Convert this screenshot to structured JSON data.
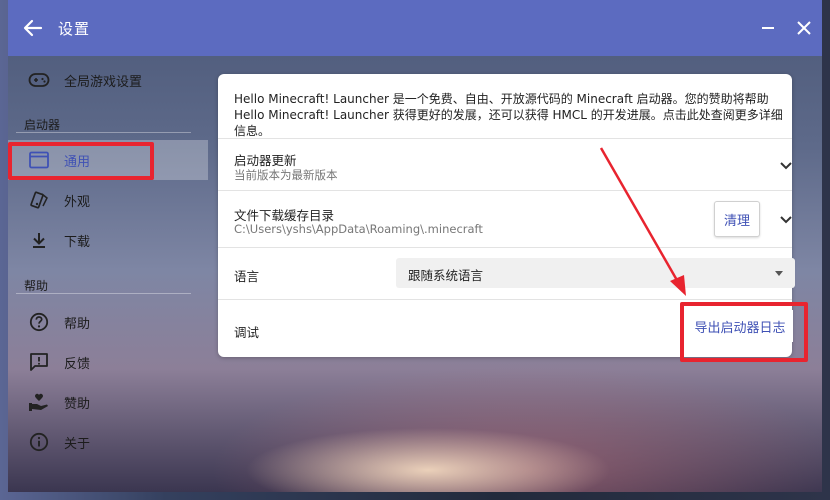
{
  "window": {
    "title": "设置"
  },
  "sidebar": {
    "items": [
      {
        "label": "全局游戏设置",
        "icon": "gamepad-icon"
      },
      {
        "label": "通用",
        "icon": "window-icon",
        "selected": true
      },
      {
        "label": "外观",
        "icon": "palette-icon"
      },
      {
        "label": "下载",
        "icon": "download-icon"
      },
      {
        "label": "帮助",
        "icon": "help-icon"
      },
      {
        "label": "反馈",
        "icon": "feedback-icon"
      },
      {
        "label": "赞助",
        "icon": "donate-icon"
      },
      {
        "label": "关于",
        "icon": "info-icon"
      }
    ],
    "sections": {
      "launcher": "启动器",
      "help": "帮助"
    }
  },
  "main": {
    "intro": "Hello Minecraft! Launcher 是一个免费、自由、开放源代码的 Minecraft 启动器。您的赞助将帮助 Hello Minecraft! Launcher 获得更好的发展，还可以获得 HMCL 的开发进展。点击此处查阅更多详细信息。",
    "update": {
      "title": "启动器更新",
      "subtitle": "当前版本为最新版本"
    },
    "cache": {
      "title": "文件下载缓存目录",
      "path": "C:\\Users\\yshs\\AppData\\Roaming\\.minecraft",
      "clean_label": "清理"
    },
    "language": {
      "label": "语言",
      "value": "跟随系统语言"
    },
    "debug": {
      "label": "调试",
      "export_label": "导出启动器日志"
    }
  },
  "colors": {
    "accent": "#5c6bc0",
    "link": "#3f51b5",
    "highlight": "#e8242f"
  }
}
